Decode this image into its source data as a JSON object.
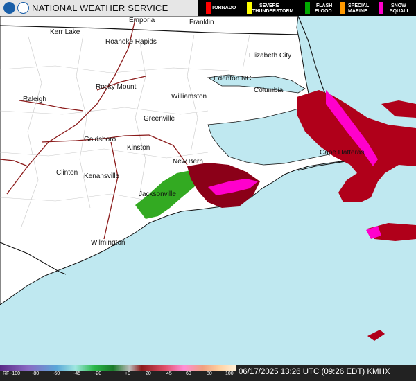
{
  "header": {
    "title": "NATIONAL WEATHER SERVICE",
    "noaa_logo": "noaa-logo",
    "nws_logo": "nws-logo"
  },
  "warnings_legend": [
    {
      "label_line1": "TORNADO",
      "label_line2": "",
      "color": "#ff0000"
    },
    {
      "label_line1": "SEVERE",
      "label_line2": "THUNDERSTORM",
      "color": "#ffff00"
    },
    {
      "label_line1": "FLASH",
      "label_line2": "FLOOD",
      "color": "#00aa00"
    },
    {
      "label_line1": "SPECIAL",
      "label_line2": "MARINE",
      "color": "#ff9900"
    },
    {
      "label_line1": "SNOW",
      "label_line2": "SQUALL",
      "color": "#ff00cc"
    }
  ],
  "cities": [
    "Emporia",
    "Franklin",
    "Kerr Lake",
    "Roanoke Rapids",
    "Elizabeth City",
    "Edenton NC",
    "Rocky Mount",
    "Raleigh",
    "Williamston",
    "Columbia",
    "Greenville",
    "Goldsboro",
    "Kinston",
    "Cape Hatteras",
    "New Bern",
    "Clinton",
    "Kenansville",
    "Jacksonville",
    "Wilmington"
  ],
  "scale": {
    "label": "RF",
    "ticks": [
      "-100",
      "-80",
      "-60",
      "-45",
      "-20",
      "+0",
      "20",
      "45",
      "60",
      "80",
      "100"
    ]
  },
  "footer": {
    "timestamp": "06/17/2025 13:26 UTC (09:26 EDT) KMHX"
  },
  "colors": {
    "ocean": "#bfe8f0",
    "land": "#ffffff",
    "roads": "#8b1a1a",
    "radar_heavy": "#b0001a",
    "radar_light": "#ff00cc",
    "radar_green": "#33aa22"
  }
}
